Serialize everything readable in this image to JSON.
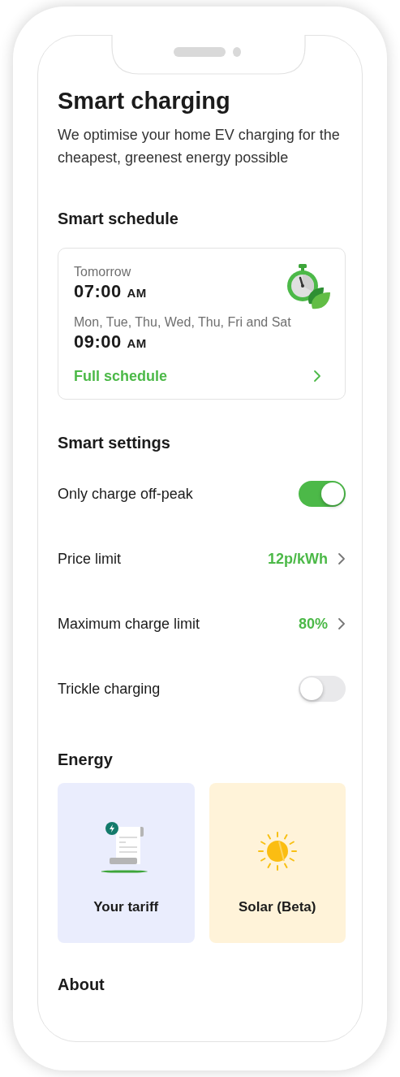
{
  "title": "Smart charging",
  "subtitle": "We optimise your home EV charging for the cheapest, greenest energy possible",
  "schedule": {
    "heading": "Smart schedule",
    "entries": [
      {
        "label": "Tomorrow",
        "time": "07:00",
        "suffix": "AM"
      },
      {
        "label": "Mon, Tue, Thu, Wed, Thu, Fri and Sat",
        "time": "09:00",
        "suffix": "AM"
      }
    ],
    "link": "Full schedule"
  },
  "settings": {
    "heading": "Smart settings",
    "rows": [
      {
        "kind": "toggle",
        "label": "Only charge off-peak",
        "on": true
      },
      {
        "kind": "value",
        "label": "Price limit",
        "value": "12p/kWh"
      },
      {
        "kind": "value",
        "label": "Maximum charge limit",
        "value": "80%"
      },
      {
        "kind": "toggle",
        "label": "Trickle charging",
        "on": false
      }
    ]
  },
  "energy": {
    "heading": "Energy",
    "tiles": [
      {
        "kind": "tariff",
        "label": "Your tariff",
        "color": "#eaedfd"
      },
      {
        "kind": "solar",
        "label": "Solar (Beta)",
        "color": "#fff3d9"
      }
    ]
  },
  "about": {
    "heading": "About"
  }
}
